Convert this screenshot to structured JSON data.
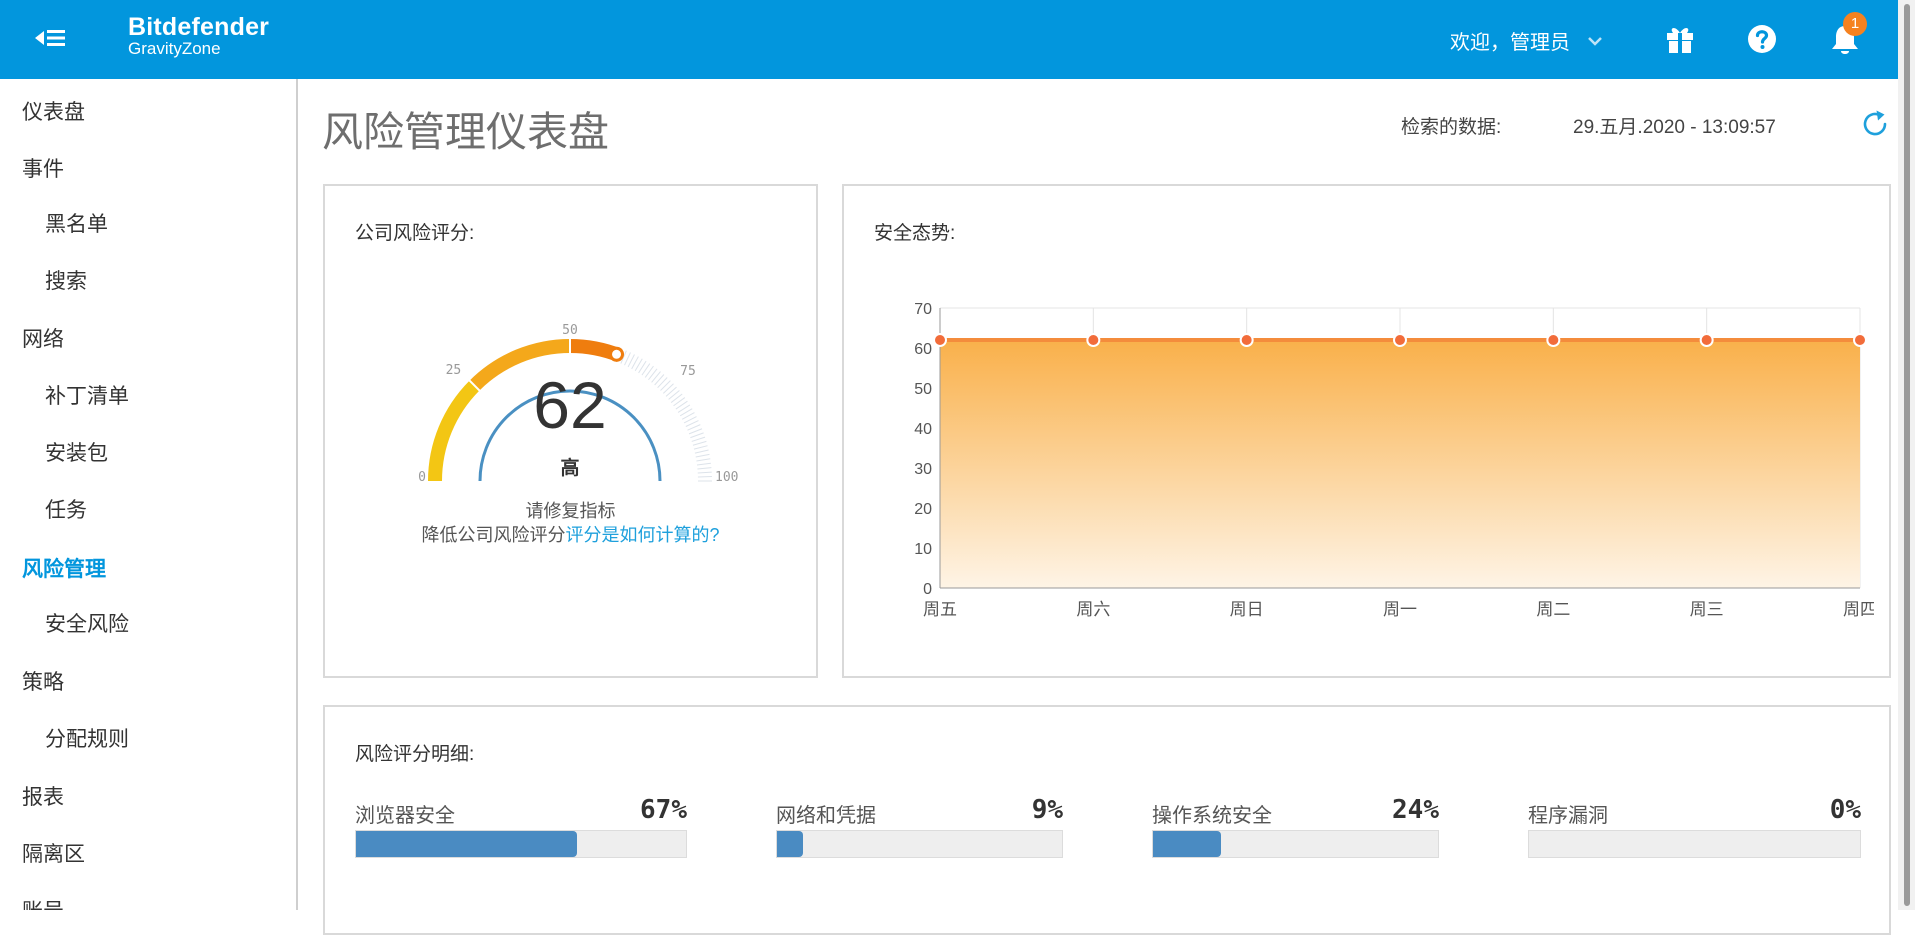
{
  "header": {
    "brand_line1": "Bitdefender",
    "brand_line2": "GravityZone",
    "welcome": "欢迎，管理员",
    "notification_count": "1"
  },
  "sidebar": {
    "items": [
      {
        "label": "仪表盘"
      },
      {
        "label": "事件"
      },
      {
        "label": "黑名单"
      },
      {
        "label": "搜索"
      },
      {
        "label": "网络"
      },
      {
        "label": "补丁清单"
      },
      {
        "label": "安装包"
      },
      {
        "label": "任务"
      },
      {
        "label": "风险管理"
      },
      {
        "label": "安全风险"
      },
      {
        "label": "策略"
      },
      {
        "label": "分配规则"
      },
      {
        "label": "报表"
      },
      {
        "label": "隔离区"
      },
      {
        "label": "账号"
      }
    ]
  },
  "main": {
    "title": "风险管理仪表盘",
    "retrieved_label": "检索的数据:",
    "retrieved_value": "29.五月.2020 - 13:09:57"
  },
  "score_panel": {
    "title": "公司风险评分:",
    "score": 62,
    "score_text": "62",
    "level": "高",
    "gauge_ticks": [
      "0",
      "25",
      "50",
      "75",
      "100"
    ],
    "hint_line1": "请修复指标",
    "hint_line2_prefix": "降低公司风险评分",
    "hint_link": "评分是如何计算的?",
    "colors": {
      "low": "#f3c614",
      "mid": "#f4a81b",
      "high": "#ef7d0e",
      "inner_arc": "#4a90c2"
    }
  },
  "posture_panel": {
    "title": "安全态势:"
  },
  "chart_data": {
    "type": "area",
    "categories": [
      "周五",
      "周六",
      "周日",
      "周一",
      "周二",
      "周三",
      "周四"
    ],
    "series": [
      {
        "values": [
          62,
          62,
          62,
          62,
          62,
          62,
          62
        ],
        "color": "#f48c3c"
      }
    ],
    "ylim": [
      0,
      70
    ],
    "yticks": [
      0,
      10,
      20,
      30,
      40,
      50,
      60,
      70
    ],
    "grid": true
  },
  "breakdown_panel": {
    "title": "风险评分明细:",
    "items": [
      {
        "label": "浏览器安全",
        "pct_text": "67%",
        "value": 67
      },
      {
        "label": "网络和凭据",
        "pct_text": "9%",
        "value": 9
      },
      {
        "label": "操作系统安全",
        "pct_text": "24%",
        "value": 24
      },
      {
        "label": "程序漏洞",
        "pct_text": "0%",
        "value": 0
      }
    ]
  }
}
